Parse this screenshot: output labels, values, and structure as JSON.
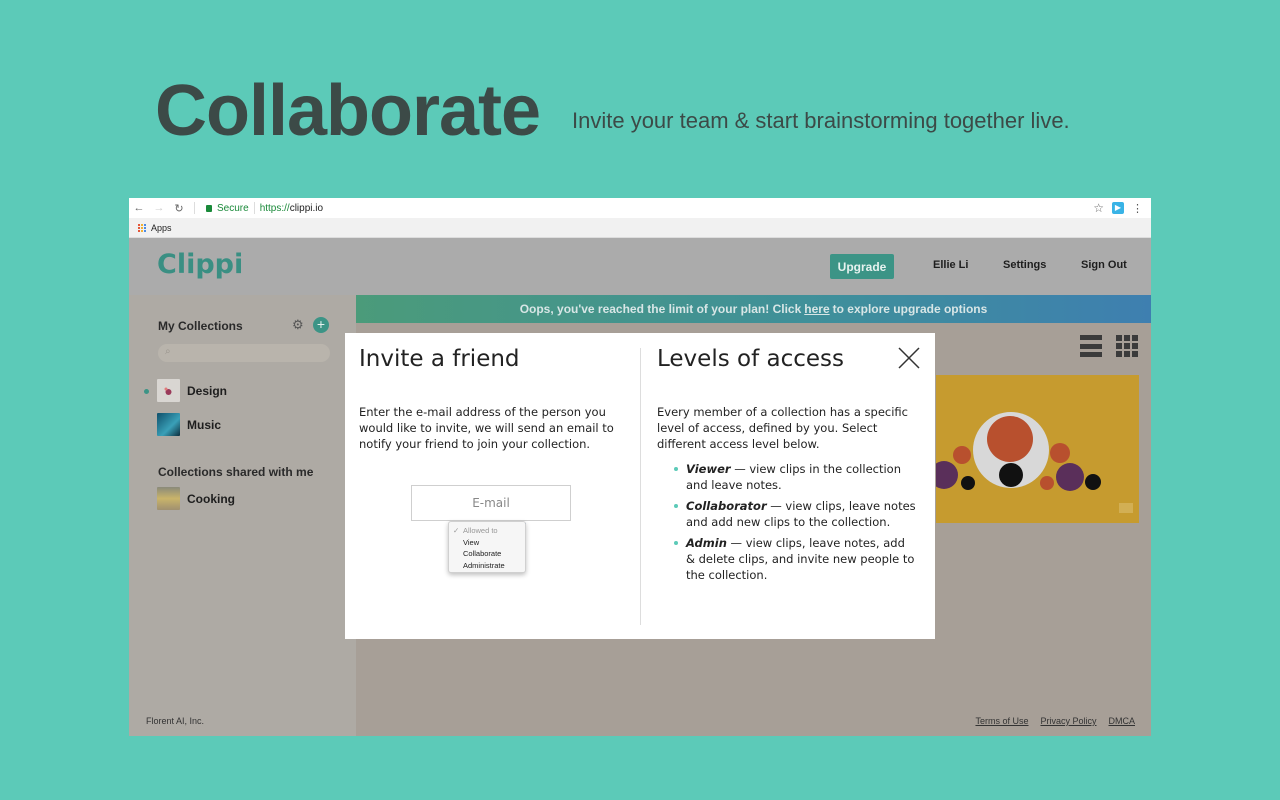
{
  "hero": {
    "title": "Collaborate",
    "subtitle": "Invite your team & start brainstorming together live."
  },
  "browser": {
    "secure_label": "Secure",
    "url_scheme": "https://",
    "url_host": "clippi.io",
    "bookmarks": {
      "apps_label": "Apps"
    }
  },
  "app": {
    "logo": "Clippi",
    "nav": {
      "upgrade": "Upgrade",
      "user": "Ellie Li",
      "settings": "Settings",
      "sign_out": "Sign Out"
    },
    "sidebar": {
      "my_collections": "My Collections",
      "collections": [
        {
          "label": "Design",
          "active": true
        },
        {
          "label": "Music",
          "active": false
        }
      ],
      "shared_heading": "Collections shared with me",
      "shared": [
        {
          "label": "Cooking"
        }
      ],
      "company": "Florent AI, Inc."
    },
    "banner": {
      "prefix": "Oops, you've reached the limit of your plan! Click",
      "link": "here",
      "suffix": "to explore upgrade options"
    },
    "footer": {
      "terms": "Terms of Use",
      "privacy": "Privacy Policy",
      "dmca": "DMCA"
    }
  },
  "modal": {
    "invite": {
      "title": "Invite a friend",
      "description": "Enter the e-mail address of the person you would like to invite, we will send an email to notify your friend to join your collection.",
      "email_placeholder": "E-mail",
      "dropdown": {
        "header": "Allowed to",
        "options": [
          "View",
          "Collaborate",
          "Administrate"
        ]
      }
    },
    "levels": {
      "title": "Levels of access",
      "description": "Every member of a collection has a specific level of access, defined by you. Select different access level below.",
      "items": [
        {
          "name": "Viewer",
          "text": " — view clips in the collection and leave notes."
        },
        {
          "name": "Collaborator",
          "text": " — view clips, leave notes and add new clips to the collection."
        },
        {
          "name": "Admin",
          "text": " — view clips, leave notes, add & delete clips, and invite new people to the collection."
        }
      ]
    }
  },
  "colors": {
    "background": "#5ccab8",
    "brand": "#3c9486",
    "card": "#c69b2f"
  }
}
